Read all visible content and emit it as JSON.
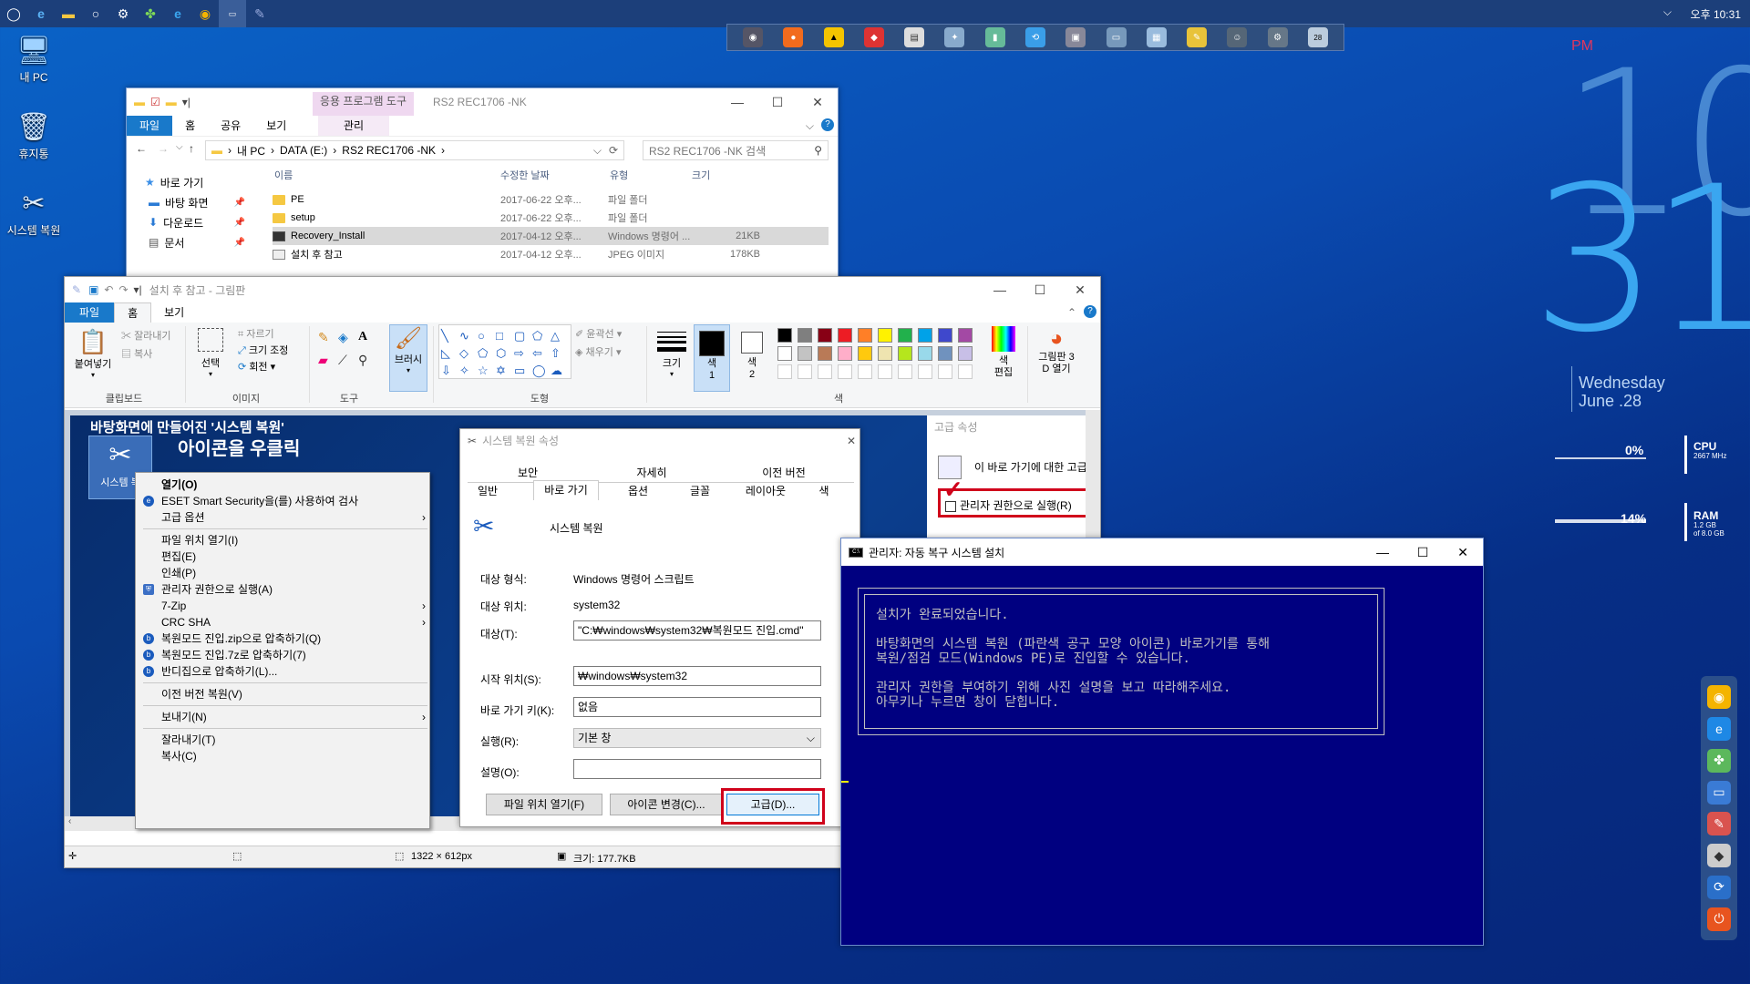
{
  "taskbar": {
    "icons": [
      "start-icon",
      "edge-icon",
      "explorer-icon",
      "cortana-icon",
      "settings-icon",
      "clover-icon",
      "ie-icon",
      "chrome-icon",
      "cmd-icon",
      "paint-icon"
    ],
    "clock": "오후 10:31"
  },
  "desktop": {
    "icons": [
      {
        "label": "내 PC"
      },
      {
        "label": "휴지통"
      },
      {
        "label": "시스템 복원"
      }
    ]
  },
  "big_clock": {
    "ampm": "PM",
    "hour": "10",
    "minute": "31",
    "day": "Wednesday",
    "date": "June .28"
  },
  "system_monitor": {
    "cpu": {
      "percent": "0%",
      "label": "CPU",
      "sub": "2667 MHz"
    },
    "ram": {
      "percent": "14%",
      "label": "RAM",
      "sub1": "1.2 GB",
      "sub2": "of 8.0 GB"
    }
  },
  "explorer": {
    "title_tab": "응용 프로그램 도구",
    "title": "RS2 REC1706 -NK",
    "tabs": [
      "파일",
      "홈",
      "공유",
      "보기"
    ],
    "manage_tab": "관리",
    "breadcrumb": [
      "내 PC",
      "DATA (E:)",
      "RS2 REC1706 -NK"
    ],
    "search_placeholder": "RS2 REC1706 -NK 검색",
    "columns": [
      "이름",
      "수정한 날짜",
      "유형",
      "크기"
    ],
    "nav": [
      {
        "label": "바로 가기"
      },
      {
        "label": "바탕 화면"
      },
      {
        "label": "다운로드"
      },
      {
        "label": "문서"
      }
    ],
    "files": [
      {
        "name": "PE",
        "date": "2017-06-22 오후...",
        "type": "파일 폴더",
        "size": ""
      },
      {
        "name": "setup",
        "date": "2017-06-22 오후...",
        "type": "파일 폴더",
        "size": ""
      },
      {
        "name": "Recovery_Install",
        "date": "2017-04-12 오후...",
        "type": "Windows 명령어 ...",
        "size": "21KB"
      },
      {
        "name": "설치 후 참고",
        "date": "2017-04-12 오후...",
        "type": "JPEG 이미지",
        "size": "178KB"
      }
    ]
  },
  "paint": {
    "title": "설치 후 참고 - 그림판",
    "tabs": [
      "파일",
      "홈",
      "보기"
    ],
    "clipboard": {
      "paste": "붙여넣기",
      "cut": "잘라내기",
      "copy": "복사",
      "label": "클립보드"
    },
    "image": {
      "select": "선택",
      "crop": "자르기",
      "resize": "크기 조정",
      "rotate": "회전",
      "label": "이미지"
    },
    "tools": {
      "label": "도구",
      "brush": "브러시"
    },
    "shapes": {
      "outline": "윤곽선",
      "fill": "채우기",
      "label": "도형"
    },
    "size_label": "크기",
    "color1": "색\n1",
    "color2": "색\n2",
    "edit_colors": "색\n편집",
    "paint3d": "그림판 3\nD 열기",
    "colors_label": "색",
    "palette": [
      "#000000",
      "#7f7f7f",
      "#880015",
      "#ed1c24",
      "#ff7f27",
      "#fff200",
      "#22b14c",
      "#00a2e8",
      "#3f48cc",
      "#a349a4",
      "#ffffff",
      "#c3c3c3",
      "#b97a57",
      "#ffaec9",
      "#ffc90e",
      "#efe4b0",
      "#b5e61d",
      "#99d9ea",
      "#7092be",
      "#c8bfe7"
    ],
    "status_dims": "1322 × 612px",
    "status_size": "크기: 177.7KB"
  },
  "canvas": {
    "heading1": "바탕화면에 만들어진 '시스템 복원'",
    "heading2": "아이콘을 우클릭",
    "icon_label": "시스템 복"
  },
  "context_menu": {
    "items": [
      {
        "label": "열기(O)",
        "bold": true
      },
      {
        "label": "ESET Smart Security을(를) 사용하여 검사",
        "icon": "e"
      },
      {
        "label": "고급 옵션",
        "submenu": true
      },
      {
        "sep": true
      },
      {
        "label": "파일 위치 열기(I)"
      },
      {
        "label": "편집(E)"
      },
      {
        "label": "인쇄(P)"
      },
      {
        "label": "관리자 권한으로 실행(A)",
        "icon": "shield"
      },
      {
        "label": "7-Zip",
        "submenu": true
      },
      {
        "label": "CRC SHA",
        "submenu": true
      },
      {
        "label": "복원모드 진입.zip으로 압축하기(Q)",
        "icon": "b"
      },
      {
        "label": "복원모드 진입.7z로 압축하기(7)",
        "icon": "b"
      },
      {
        "label": "반디집으로 압축하기(L)...",
        "icon": "b"
      },
      {
        "sep": true
      },
      {
        "label": "이전 버전 복원(V)"
      },
      {
        "sep": true
      },
      {
        "label": "보내기(N)",
        "submenu": true
      },
      {
        "sep": true
      },
      {
        "label": "잘라내기(T)"
      },
      {
        "label": "복사(C)"
      }
    ]
  },
  "properties": {
    "title": "시스템 복원 속성",
    "tabs_row1": [
      "보안",
      "자세히",
      "이전 버전"
    ],
    "tabs_row2": [
      "일반",
      "바로 가기",
      "옵션",
      "글꼴",
      "레이아웃",
      "색"
    ],
    "name": "시스템 복원",
    "target_type_label": "대상 형식:",
    "target_type": "Windows 명령어 스크립트",
    "target_location_label": "대상 위치:",
    "target_location": "system32",
    "target_label": "대상(T):",
    "target": "\"C:₩windows₩system32₩복원모드 진입.cmd\"",
    "start_in_label": "시작 위치(S):",
    "start_in": "₩windows₩system32",
    "shortcut_key_label": "바로 가기 키(K):",
    "shortcut_key": "없음",
    "run_label": "실행(R):",
    "run": "기본 창",
    "comment_label": "설명(O):",
    "comment": "",
    "btn_open_location": "파일 위치 열기(F)",
    "btn_change_icon": "아이콘 변경(C)...",
    "btn_advanced": "고급(D)..."
  },
  "advanced": {
    "title": "고급 속성",
    "description": "이 바로 가기에 대한 고급 속성을",
    "run_as_admin": "관리자 권한으로 실행(R)"
  },
  "cmd": {
    "title": "관리자:  자동 복구 시스템 설치",
    "lines": [
      "설치가 완료되었습니다.",
      "",
      "바탕화면의 시스템 복원 (파란색 공구 모양 아이콘) 바로가기를 통해",
      "복원/점검 모드(Windows PE)로 진입할 수 있습니다.",
      "",
      "관리자 권한을 부여하기 위해 사진 설명을 보고 따라해주세요.",
      "아무키나 누르면 창이 닫힙니다."
    ]
  },
  "colors": {
    "accent": "#1979ca",
    "cmd_bg": "#000080",
    "highlight_red": "#d0021b"
  }
}
